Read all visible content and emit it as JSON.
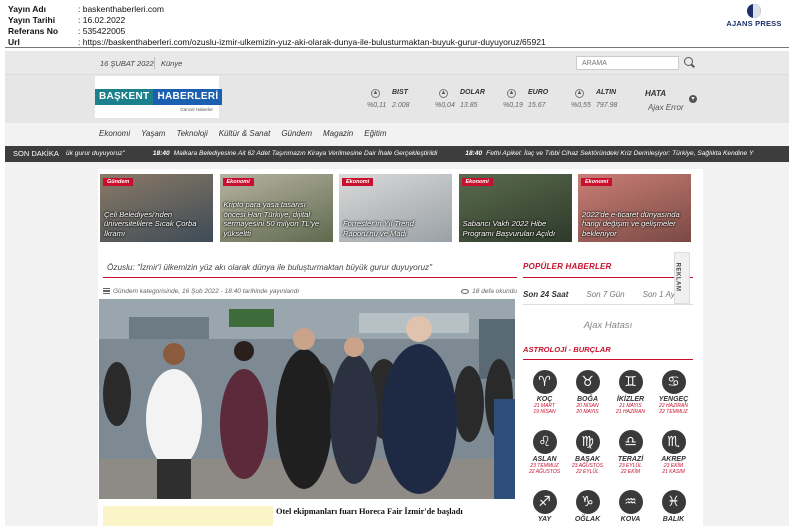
{
  "clip": {
    "rows": [
      {
        "key": "Yayın Adı",
        "value": ": baskenthaberleri.com"
      },
      {
        "key": "Yayın Tarihi",
        "value": ": 16.02.2022"
      },
      {
        "key": "Referans No",
        "value": ": 535422005"
      },
      {
        "key": "Url",
        "value": ": https://baskenthaberleri.com/ozuslu-izmir-ulkemizin-yuz-aki-olarak-dunya-ile-bulusturmaktan-buyuk-gurur-duyuyoruz/65921"
      }
    ],
    "agency": "AJANS PRESS"
  },
  "topbar": {
    "date": "16 ŞUBAT 2022",
    "kunye": "Künye",
    "search_placeholder": "ARAMA"
  },
  "logo": {
    "part1": "BAŞKENT",
    "part2": "HABERLERİ",
    "sub": "Güncel Haberler"
  },
  "markets": [
    {
      "name": "BIST",
      "change": "%0,11",
      "value": "2.008"
    },
    {
      "name": "DOLAR",
      "change": "%0,04",
      "value": "13.85"
    },
    {
      "name": "EURO",
      "change": "%0,19",
      "value": "15.67"
    },
    {
      "name": "ALTIN",
      "change": "%0,55",
      "value": "797.98"
    }
  ],
  "weather": {
    "title": "HATA",
    "error": "Ajax Error"
  },
  "nav": [
    "Ekonomi",
    "Yaşam",
    "Teknoloji",
    "Kültür & Sanat",
    "Gündem",
    "Magazin",
    "Eğitim"
  ],
  "ticker": {
    "label": "SON DAKİKA",
    "lead": "ük gurur duyuyoruz\"",
    "items": [
      {
        "time": "18:40",
        "text": "Malkara Belediyesine Ait 62 Adet Taşınmazın Kiraya Verilmesine Dair İhale Gerçekleştirildi"
      },
      {
        "time": "18:40",
        "text": "Fethi Apikel: İlaç ve Tıbbi Cihaz Sektöründeki Kriz Derinleşiyor: Türkiye, Sağlıkta Kendine Y"
      }
    ]
  },
  "cards": [
    {
      "badge": "Gündem",
      "title": "Çeli Belediyesi'nden üniversitelilere Sıcak Çorba İkramı",
      "color1": "#8a7a66",
      "color2": "#3e4b57"
    },
    {
      "badge": "Ekonomi",
      "title": "Kripto para yasa tasarısı öncesi Han Türkiye, dijital sermayesini 50 milyon TL'ye yükseltti",
      "color1": "#b7b3a2",
      "color2": "#5f6a4d"
    },
    {
      "badge": "Ekonomi",
      "title": "Forrester'ın Yıl Trend Raporu'nu ve Madi",
      "color1": "#d9d9d9",
      "color2": "#9aa1a6"
    },
    {
      "badge": "Ekonomi",
      "title": "Sabancı Vakfı 2022 Hibe Programı Başvuruları Açıldı",
      "color1": "#5a6b4f",
      "color2": "#2f3a2a"
    },
    {
      "badge": "Ekonomi",
      "title": "2022'de e-ticaret dünyasında hangi değişim ve gelişmeler bekleniyor",
      "color1": "#c97e76",
      "color2": "#7a4a44"
    }
  ],
  "article": {
    "title": "Özuslu: \"İzmir'i ülkemizin yüz akı olarak dünya ile buluşturmaktan büyük gurur duyuyoruz\"",
    "info": "Gündem kategorisinde, 16 Şub 2022 - 18:40 tarihinde yayınlandı",
    "views": "18 defa okundu",
    "caption": "Otel ekipmanları fuarı Horeca Fair İzmir'de başladı"
  },
  "sidebar": {
    "popular_title": "POPÜLER HABERLER",
    "tabs": [
      "Son 24 Saat",
      "Son 7 Gün",
      "Son 1 Ay"
    ],
    "error": "Ajax Hatası",
    "reklam": "REKLAM",
    "astro_title": "ASTROLOJİ - BURÇLAR",
    "zodiac": [
      {
        "name": "KOÇ",
        "dates": "21 MART\n19 NİSAN",
        "glyph": "♈"
      },
      {
        "name": "BOĞA",
        "dates": "20 NİSAN\n20 MAYIS",
        "glyph": "♉"
      },
      {
        "name": "İKİZLER",
        "dates": "21 MAYIS\n21 HAZİRAN",
        "glyph": "♊"
      },
      {
        "name": "YENGEÇ",
        "dates": "22 HAZİRAN\n22 TEMMUZ",
        "glyph": "♋"
      },
      {
        "name": "ASLAN",
        "dates": "23 TEMMUZ\n22 AĞUSTOS",
        "glyph": "♌"
      },
      {
        "name": "BAŞAK",
        "dates": "23 AĞUSTOS\n22 EYLÜL",
        "glyph": "♍"
      },
      {
        "name": "TERAZİ",
        "dates": "23 EYLÜL\n22 EKİM",
        "glyph": "♎"
      },
      {
        "name": "AKREP",
        "dates": "23 EKİM\n21 KASIM",
        "glyph": "♏"
      },
      {
        "name": "YAY",
        "dates": "",
        "glyph": "♐"
      },
      {
        "name": "OĞLAK",
        "dates": "",
        "glyph": "♑"
      },
      {
        "name": "KOVA",
        "dates": "",
        "glyph": "♒"
      },
      {
        "name": "BALIK",
        "dates": "",
        "glyph": "♓"
      }
    ]
  },
  "colors": {
    "accent": "#c8102e",
    "ticker_bg": "#3d3d3d",
    "logo_teal": "#1b7f8c",
    "logo_blue": "#1b5fb0"
  }
}
